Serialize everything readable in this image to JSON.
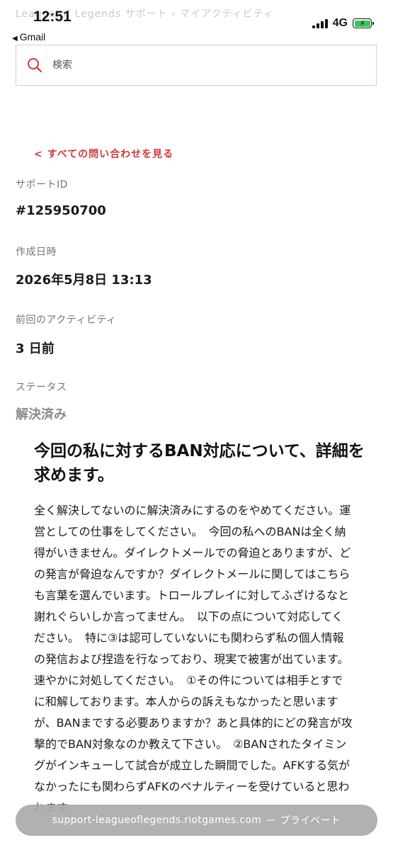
{
  "status_bar": {
    "time": "12:51",
    "back_app": "Gmail",
    "network": "4G",
    "battery_color": "#35c759"
  },
  "breadcrumb": {
    "text": "League of Legends サポート  ›  マイアクティビティ"
  },
  "search": {
    "placeholder": "検索",
    "icon": "search-icon"
  },
  "back_link": "< すべての問い合わせを見る",
  "fields": {
    "support_id_label": "サポートID",
    "support_id_value": "#125950700",
    "created_label": "作成日時",
    "created_value": "2026年5月8日 13:13",
    "last_activity_label": "前回のアクティビティ",
    "last_activity_value": "3 日前",
    "status_label": "ステータス",
    "status_value": "解決済み"
  },
  "message": {
    "title": "今回の私に対するBAN対応について、詳細を求めます。",
    "body": "全く解決してないのに解決済みにするのをやめてください。運営としての仕事をしてください。　今回の私へのBANは全く納得がいきません。ダイレクトメールでの脅迫とありますが、どの発言が脅迫なんですか？ダイレクトメールに関してはこちらも言葉を選んでいます。トロールプレイに対してふざけるなと謝れぐらいしか言ってません。　以下の点について対応してください。　特に③は認可していないにも関わらず私の個人情報の発信および捏造を行なっており、現実で被害が出ています。速やかに対処してください。　①その件については相手とすでに和解しております。本人からの訴えもなかったと思いますが、BANまでする必要ありますか？あと具体的にどの発言が攻撃的でBAN対象なのか教えて下さい。　②BANされたタイミングがインキューして試合が成立した瞬間でした。AFKする気がなかったにも関わらずAFKのペナルティーを受けていると思われます。"
  },
  "url_bar": {
    "domain": "support-leagueoflegends.riotgames.com",
    "dash": "—",
    "mode": "プライベート"
  },
  "colors": {
    "accent": "#d13639",
    "status_resolved": "#8a8a8a"
  }
}
